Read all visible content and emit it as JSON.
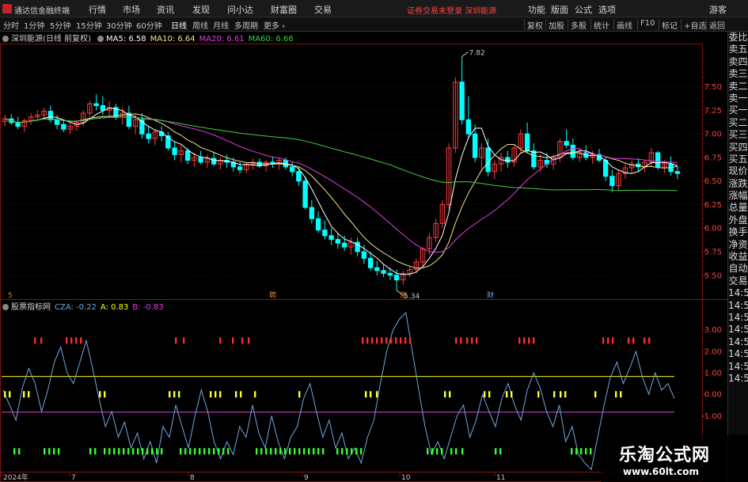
{
  "titlebar": {
    "app_title": "通达信金融终端",
    "menus": [
      "行情",
      "市场",
      "资讯",
      "发现",
      "问小达",
      "财富圈",
      "交易"
    ],
    "notice": "证券交易未登录",
    "stock_link": "深圳能源",
    "right_menus": [
      "功能",
      "版面",
      "公式",
      "选项"
    ],
    "guest": "游客"
  },
  "toolbar": {
    "periods": [
      "分时",
      "1分钟",
      "5分钟",
      "15分钟",
      "30分钟",
      "60分钟",
      "日线",
      "周线",
      "月线",
      "多周期",
      "更多"
    ],
    "active_period": "日线",
    "buttons": [
      "复权",
      "加股",
      "多股",
      "统计",
      "画线",
      "F10",
      "标记",
      "+自选",
      "返回"
    ]
  },
  "main_indicator": {
    "name": "深圳能源(日线 前复权)",
    "items": [
      {
        "label": "MA5: 6.58",
        "color": "#ffffff"
      },
      {
        "label": "MA10: 6.64",
        "color": "#f0e68c"
      },
      {
        "label": "MA20: 6.61",
        "color": "#e040e0"
      },
      {
        "label": "MA60: 6.66",
        "color": "#3dd13d"
      }
    ]
  },
  "sub_indicator": {
    "name": "股票指标网",
    "items": [
      {
        "label": "CZA: -0.22",
        "color": "#6fa8dc"
      },
      {
        "label": "A: 0.83",
        "color": "#ffff00"
      },
      {
        "label": "B: -0.83",
        "color": "#e040e0"
      }
    ]
  },
  "sidebar": [
    "委比",
    "卖五",
    "卖四",
    "卖三",
    "卖二",
    "卖一",
    "买一",
    "买二",
    "买三",
    "买四",
    "买五",
    "现价",
    "涨跌",
    "涨幅",
    "总量",
    "外盘",
    "换手",
    "净资",
    "收益",
    "自动",
    "交易",
    "14:50",
    "14:50",
    "14:50",
    "14:50",
    "14:50",
    "14:50",
    "14:50",
    "14:50"
  ],
  "watermark": {
    "title": "乐淘公式网",
    "url": "www.60lt.com"
  },
  "colors": {
    "up": "#ff3b3b",
    "down": "#00ffff",
    "ma5": "#ffffff",
    "ma10": "#f0e68c",
    "ma20": "#e040e0",
    "ma60": "#3dd13d",
    "cza": "#6fa8dc",
    "line_a": "#ffff00",
    "line_b": "#e040e0",
    "grid": "#8b1a1a",
    "axis_text": "#ff4040"
  },
  "chart_data": [
    {
      "type": "candlestick",
      "title": "深圳能源(日线 前复权)",
      "x_labels": [
        "2024年",
        "7",
        "8",
        "9",
        "10",
        "11"
      ],
      "y_ticks": [
        7.5,
        7.25,
        7.0,
        6.75,
        6.5,
        6.25,
        6.0,
        5.75,
        5.5
      ],
      "ylim": [
        5.33,
        7.9
      ],
      "annotations": [
        {
          "text": "7.82",
          "value": 7.82
        },
        {
          "text": "5.34",
          "value": 5.34
        }
      ],
      "event_markers": [
        "5",
        "聘",
        "涨",
        "财"
      ],
      "ohlc": [
        [
          7.13,
          7.2,
          7.08,
          7.16
        ],
        [
          7.16,
          7.21,
          7.1,
          7.12
        ],
        [
          7.12,
          7.18,
          7.05,
          7.08
        ],
        [
          7.08,
          7.16,
          7.02,
          7.14
        ],
        [
          7.14,
          7.22,
          7.1,
          7.18
        ],
        [
          7.18,
          7.25,
          7.14,
          7.2
        ],
        [
          7.2,
          7.28,
          7.15,
          7.24
        ],
        [
          7.24,
          7.3,
          7.12,
          7.15
        ],
        [
          7.15,
          7.2,
          7.05,
          7.1
        ],
        [
          7.1,
          7.15,
          7.02,
          7.05
        ],
        [
          7.05,
          7.12,
          7.0,
          7.08
        ],
        [
          7.08,
          7.15,
          7.03,
          7.12
        ],
        [
          7.12,
          7.25,
          7.08,
          7.22
        ],
        [
          7.22,
          7.35,
          7.18,
          7.32
        ],
        [
          7.32,
          7.42,
          7.25,
          7.3
        ],
        [
          7.3,
          7.4,
          7.2,
          7.25
        ],
        [
          7.25,
          7.35,
          7.18,
          7.28
        ],
        [
          7.28,
          7.32,
          7.15,
          7.18
        ],
        [
          7.18,
          7.28,
          7.1,
          7.22
        ],
        [
          7.22,
          7.3,
          7.05,
          7.08
        ],
        [
          7.08,
          7.2,
          7.0,
          7.15
        ],
        [
          7.15,
          7.22,
          6.95,
          7.0
        ],
        [
          7.0,
          7.08,
          6.9,
          6.95
        ],
        [
          6.95,
          7.05,
          6.88,
          7.02
        ],
        [
          7.02,
          7.08,
          6.92,
          6.98
        ],
        [
          6.98,
          7.02,
          6.82,
          6.85
        ],
        [
          6.85,
          6.92,
          6.72,
          6.78
        ],
        [
          6.78,
          6.88,
          6.7,
          6.82
        ],
        [
          6.82,
          6.85,
          6.68,
          6.72
        ],
        [
          6.72,
          6.8,
          6.65,
          6.75
        ],
        [
          6.75,
          6.82,
          6.68,
          6.7
        ],
        [
          6.7,
          6.78,
          6.64,
          6.74
        ],
        [
          6.74,
          6.8,
          6.66,
          6.68
        ],
        [
          6.68,
          6.76,
          6.62,
          6.72
        ],
        [
          6.72,
          6.78,
          6.64,
          6.7
        ],
        [
          6.7,
          6.75,
          6.6,
          6.65
        ],
        [
          6.65,
          6.7,
          6.58,
          6.62
        ],
        [
          6.62,
          6.7,
          6.58,
          6.68
        ],
        [
          6.68,
          6.74,
          6.62,
          6.7
        ],
        [
          6.7,
          6.74,
          6.64,
          6.66
        ],
        [
          6.66,
          6.72,
          6.6,
          6.7
        ],
        [
          6.7,
          6.76,
          6.64,
          6.68
        ],
        [
          6.68,
          6.75,
          6.62,
          6.72
        ],
        [
          6.72,
          6.75,
          6.62,
          6.65
        ],
        [
          6.65,
          6.7,
          6.55,
          6.6
        ],
        [
          6.6,
          6.65,
          6.45,
          6.5
        ],
        [
          6.5,
          6.55,
          6.2,
          6.22
        ],
        [
          6.22,
          6.3,
          6.05,
          6.1
        ],
        [
          6.1,
          6.18,
          5.95,
          5.98
        ],
        [
          5.98,
          6.08,
          5.88,
          5.92
        ],
        [
          5.92,
          6.0,
          5.82,
          5.88
        ],
        [
          5.88,
          5.95,
          5.78,
          5.84
        ],
        [
          5.84,
          5.92,
          5.76,
          5.8
        ],
        [
          5.8,
          5.9,
          5.72,
          5.85
        ],
        [
          5.85,
          5.9,
          5.7,
          5.75
        ],
        [
          5.75,
          5.82,
          5.62,
          5.68
        ],
        [
          5.68,
          5.75,
          5.55,
          5.58
        ],
        [
          5.58,
          5.65,
          5.5,
          5.55
        ],
        [
          5.55,
          5.62,
          5.48,
          5.52
        ],
        [
          5.52,
          5.58,
          5.45,
          5.5
        ],
        [
          5.5,
          5.56,
          5.34,
          5.45
        ],
        [
          5.45,
          5.55,
          5.4,
          5.52
        ],
        [
          5.52,
          5.6,
          5.48,
          5.56
        ],
        [
          5.56,
          5.68,
          5.52,
          5.64
        ],
        [
          5.64,
          5.8,
          5.6,
          5.78
        ],
        [
          5.78,
          5.95,
          5.72,
          5.9
        ],
        [
          5.9,
          6.1,
          5.85,
          6.05
        ],
        [
          6.05,
          6.3,
          6.0,
          6.25
        ],
        [
          6.25,
          6.9,
          6.2,
          6.85
        ],
        [
          6.85,
          7.6,
          6.8,
          7.55
        ],
        [
          7.55,
          7.82,
          7.1,
          7.15
        ],
        [
          7.15,
          7.4,
          6.95,
          7.0
        ],
        [
          7.0,
          7.1,
          6.7,
          6.75
        ],
        [
          6.75,
          6.9,
          6.6,
          6.85
        ],
        [
          6.85,
          6.95,
          6.55,
          6.6
        ],
        [
          6.6,
          6.72,
          6.52,
          6.68
        ],
        [
          6.68,
          6.8,
          6.6,
          6.75
        ],
        [
          6.75,
          6.82,
          6.64,
          6.7
        ],
        [
          6.7,
          6.88,
          6.65,
          6.85
        ],
        [
          6.85,
          7.05,
          6.8,
          7.0
        ],
        [
          7.0,
          7.12,
          6.8,
          6.82
        ],
        [
          6.82,
          6.9,
          6.62,
          6.65
        ],
        [
          6.65,
          6.78,
          6.6,
          6.72
        ],
        [
          6.72,
          6.8,
          6.64,
          6.68
        ],
        [
          6.68,
          6.78,
          6.62,
          6.75
        ],
        [
          6.75,
          6.95,
          6.7,
          6.92
        ],
        [
          6.92,
          7.05,
          6.85,
          6.88
        ],
        [
          6.88,
          6.95,
          6.72,
          6.75
        ],
        [
          6.75,
          6.85,
          6.7,
          6.8
        ],
        [
          6.8,
          6.88,
          6.72,
          6.75
        ],
        [
          6.75,
          6.82,
          6.68,
          6.78
        ],
        [
          6.78,
          6.84,
          6.7,
          6.72
        ],
        [
          6.72,
          6.75,
          6.5,
          6.55
        ],
        [
          6.55,
          6.62,
          6.38,
          6.45
        ],
        [
          6.45,
          6.62,
          6.4,
          6.58
        ],
        [
          6.58,
          6.68,
          6.52,
          6.64
        ],
        [
          6.64,
          6.72,
          6.58,
          6.68
        ],
        [
          6.68,
          6.74,
          6.6,
          6.65
        ],
        [
          6.65,
          6.72,
          6.6,
          6.7
        ],
        [
          6.7,
          6.85,
          6.65,
          6.8
        ],
        [
          6.8,
          6.82,
          6.62,
          6.65
        ],
        [
          6.65,
          6.72,
          6.58,
          6.68
        ],
        [
          6.68,
          6.76,
          6.56,
          6.6
        ],
        [
          6.6,
          6.66,
          6.52,
          6.58
        ]
      ]
    },
    {
      "type": "line",
      "title": "股票指标网",
      "y_ticks": [
        3.0,
        2.0,
        1.0,
        0.0,
        -1.0
      ],
      "ylim": [
        -3.6,
        3.8
      ],
      "series": [
        {
          "name": "CZA",
          "values": [
            0.2,
            -0.5,
            -1.2,
            0.3,
            1.2,
            0.5,
            -0.8,
            0.2,
            1.5,
            2.2,
            1.0,
            0.5,
            1.5,
            2.5,
            1.2,
            -0.2,
            -1.5,
            -0.8,
            -2.0,
            -1.3,
            -2.5,
            -1.8,
            -3.0,
            -2.2,
            -3.2,
            -1.5,
            -2.0,
            -0.5,
            -1.5,
            -2.5,
            -1.0,
            0.2,
            -0.8,
            -2.2,
            -3.0,
            -2.2,
            -2.8,
            -1.5,
            -2.0,
            -0.5,
            -1.8,
            -2.5,
            -1.0,
            -2.2,
            -3.0,
            -2.0,
            -1.5,
            -0.2,
            0.5,
            -0.8,
            -2.0,
            -1.2,
            -2.5,
            -1.8,
            -3.0,
            -2.5,
            -3.2,
            -2.0,
            -1.2,
            0.5,
            2.0,
            3.0,
            3.5,
            3.8,
            2.0,
            0.2,
            -1.5,
            -2.8,
            -2.2,
            -3.0,
            -2.0,
            -1.0,
            -0.5,
            -2.0,
            -1.2,
            0.0,
            -0.8,
            -1.5,
            -0.2,
            0.5,
            -0.5,
            -1.2,
            0.2,
            1.0,
            0.3,
            -0.8,
            -1.5,
            -0.5,
            -2.2,
            -1.5,
            -2.8,
            -3.2,
            -3.5,
            -2.0,
            -0.5,
            0.8,
            1.5,
            0.5,
            1.2,
            2.0,
            0.8,
            0.0,
            1.0,
            0.2,
            0.5,
            -0.2
          ],
          "color": "#6fa8dc"
        },
        {
          "name": "A",
          "values": [
            0.83
          ],
          "color": "#ffff00"
        },
        {
          "name": "B",
          "values": [
            -0.83
          ],
          "color": "#e040e0"
        }
      ]
    }
  ]
}
